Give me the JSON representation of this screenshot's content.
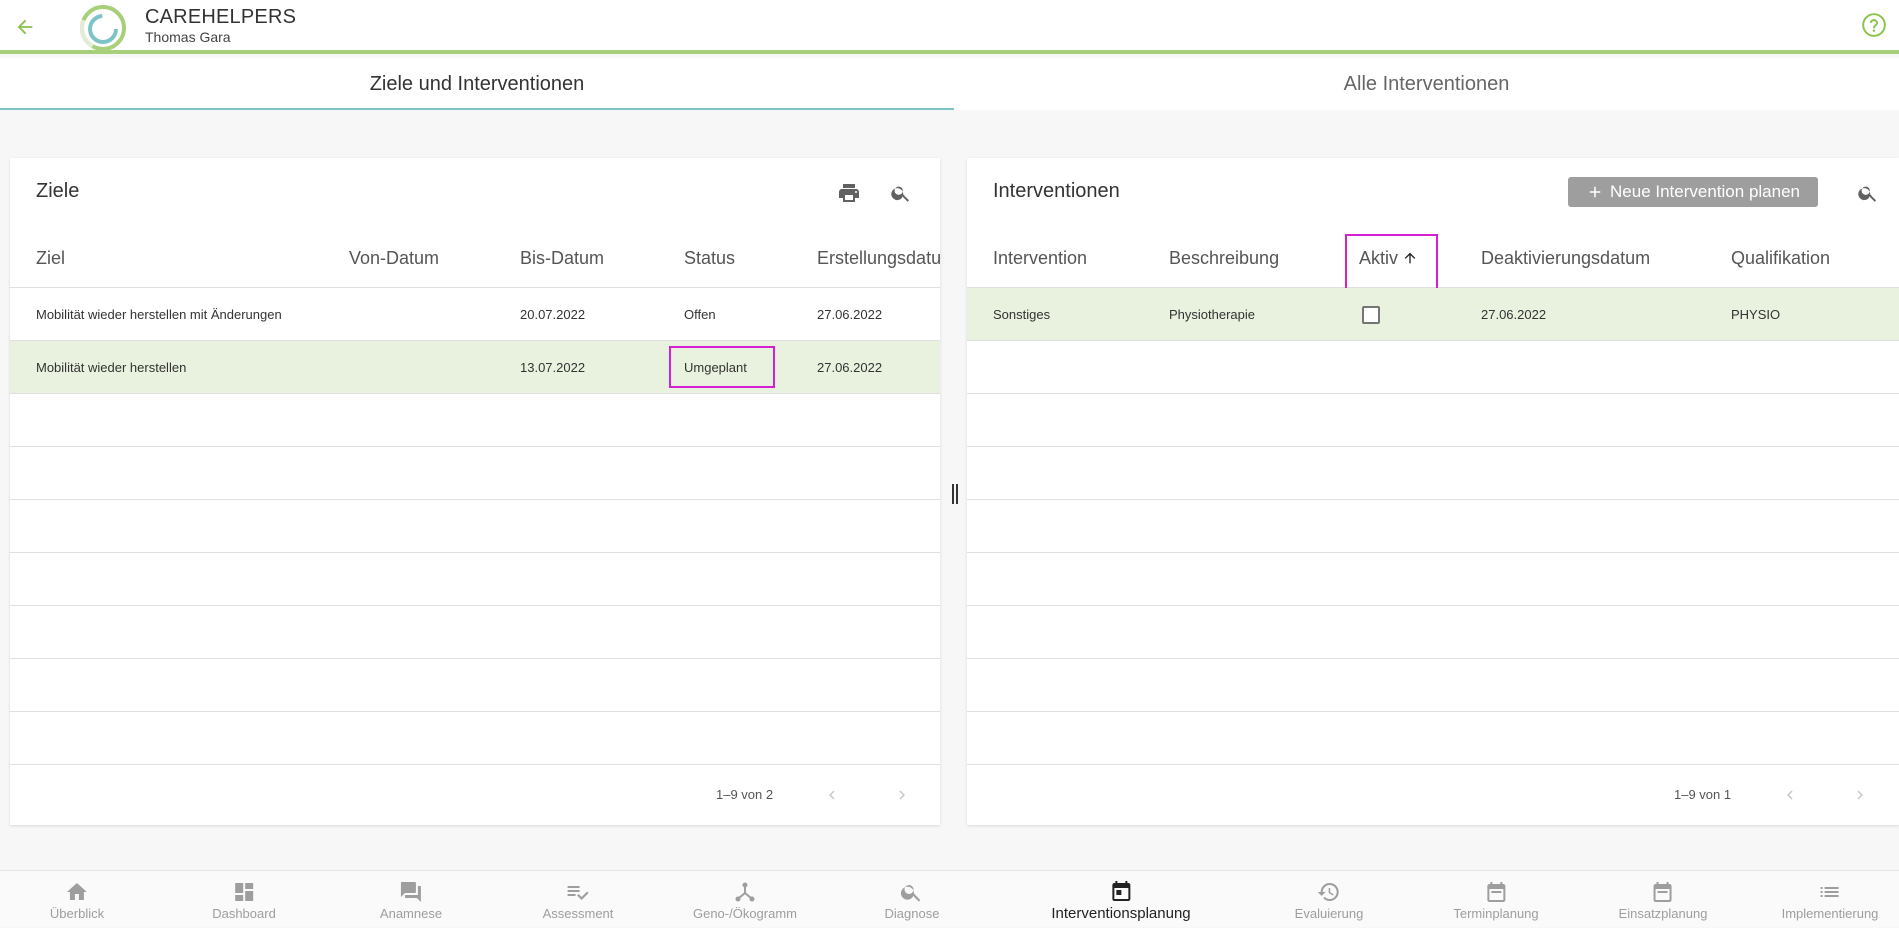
{
  "header": {
    "app_name": "CAREHELPERS",
    "user_name": "Thomas Gara"
  },
  "tabs": [
    {
      "label": "Ziele und Interventionen",
      "active": true
    },
    {
      "label": "Alle Interventionen",
      "active": false
    }
  ],
  "ziele": {
    "title": "Ziele",
    "columns": [
      "Ziel",
      "Von-Datum",
      "Bis-Datum",
      "Status",
      "Erstellungsdatu"
    ],
    "rows": [
      {
        "ziel": "Mobilität wieder herstellen mit Änderungen",
        "von": "",
        "bis": "20.07.2022",
        "status": "Offen",
        "erstellt": "27.06.2022"
      },
      {
        "ziel": "Mobilität wieder herstellen",
        "von": "",
        "bis": "13.07.2022",
        "status": "Umgeplant",
        "erstellt": "27.06.2022"
      }
    ],
    "pager": "1–9 von 2"
  },
  "interventionen": {
    "title": "Interventionen",
    "new_button": "Neue Intervention planen",
    "columns": [
      "Intervention",
      "Beschreibung",
      "Aktiv",
      "Deaktivierungsdatum",
      "Qualifikation"
    ],
    "rows": [
      {
        "intervention": "Sonstiges",
        "beschreibung": "Physiotherapie",
        "aktiv": false,
        "deaktiviert": "27.06.2022",
        "qualifikation": "PHYSIO"
      }
    ],
    "pager": "1–9 von 1"
  },
  "bottom_nav": [
    {
      "label": "Überblick",
      "icon": "home-icon"
    },
    {
      "label": "Dashboard",
      "icon": "dashboard-icon"
    },
    {
      "label": "Anamnese",
      "icon": "chat-icon"
    },
    {
      "label": "Assessment",
      "icon": "checklist-icon"
    },
    {
      "label": "Geno-/Ökogramm",
      "icon": "genogram-icon"
    },
    {
      "label": "Diagnose",
      "icon": "search-icon"
    },
    {
      "label": "Interventionsplanung",
      "icon": "calendar-icon",
      "active": true
    },
    {
      "label": "Evaluierung",
      "icon": "history-icon"
    },
    {
      "label": "Terminplanung",
      "icon": "calendar-icon"
    },
    {
      "label": "Einsatzplanung",
      "icon": "calendar-icon"
    },
    {
      "label": "Implementierung",
      "icon": "list-icon"
    }
  ],
  "colors": {
    "accent_green": "#a8cf7a",
    "tab_underline": "#7ec3c6",
    "selected_row": "#e8f2df",
    "highlight": "#d61fd1"
  }
}
